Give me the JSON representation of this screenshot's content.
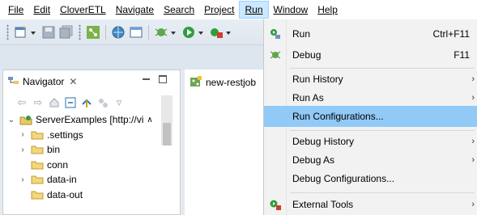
{
  "menubar": {
    "items": [
      {
        "label": "File"
      },
      {
        "label": "Edit"
      },
      {
        "label": "CloverETL"
      },
      {
        "label": "Navigate"
      },
      {
        "label": "Search"
      },
      {
        "label": "Project"
      },
      {
        "label": "Run"
      },
      {
        "label": "Window"
      },
      {
        "label": "Help"
      }
    ],
    "active": "Run"
  },
  "navigator": {
    "title": "Navigator",
    "close_glyph": "✕",
    "tree": [
      {
        "label": "ServerExamples [http://vi",
        "expanded": true,
        "level": 0
      },
      {
        "label": ".settings",
        "expanded": false,
        "level": 1
      },
      {
        "label": "bin",
        "expanded": false,
        "level": 1
      },
      {
        "label": "conn",
        "expanded": null,
        "level": 1
      },
      {
        "label": "data-in",
        "expanded": false,
        "level": 1
      },
      {
        "label": "data-out",
        "expanded": null,
        "level": 1
      }
    ]
  },
  "editor": {
    "tab_label": "new-restjob"
  },
  "run_menu": {
    "items": [
      {
        "label": "Run",
        "accel": "Ctrl+F11",
        "icon": "run-icon"
      },
      {
        "label": "Debug",
        "accel": "F11",
        "icon": "debug-icon"
      },
      {
        "label": "Run History",
        "submenu": true
      },
      {
        "label": "Run As",
        "submenu": true
      },
      {
        "label": "Run Configurations...",
        "highlighted": true
      },
      {
        "label": "Debug History",
        "submenu": true
      },
      {
        "label": "Debug As",
        "submenu": true
      },
      {
        "label": "Debug Configurations..."
      },
      {
        "label": "External Tools",
        "submenu": true,
        "icon": "external-tools-icon"
      }
    ],
    "submenu_arrow": "›"
  },
  "colors": {
    "highlight": "#91c9f7",
    "menubar_active": "#cce8ff",
    "run_green": "#3a9a3a",
    "folder_yellow": "#e8c86a"
  }
}
